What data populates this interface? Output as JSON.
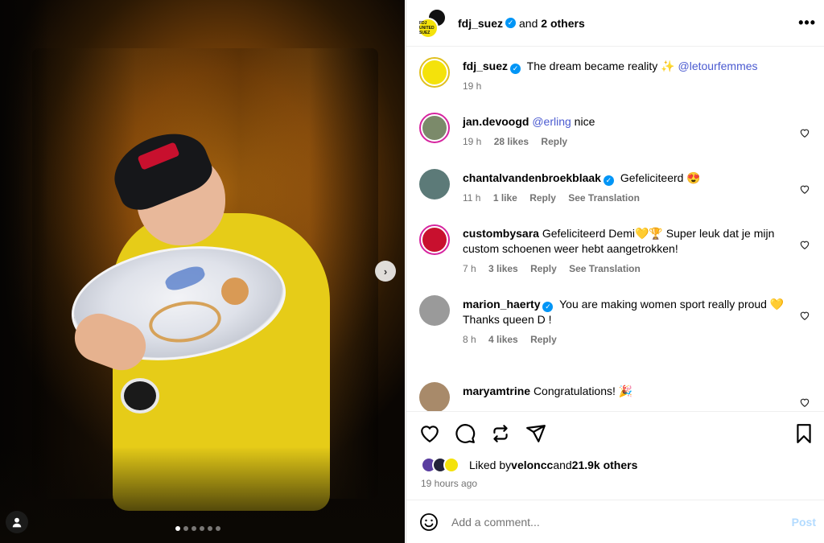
{
  "post": {
    "header": {
      "username": "fdj_suez",
      "and": "and",
      "others": "2 others",
      "more": "•••",
      "avatar_text": "FDJ UNITED SUEZ"
    },
    "next_arrow": "›",
    "carousel_dots": 6,
    "caption": {
      "username": "fdj_suez",
      "text": "The dream became reality ✨",
      "mention": "@letourfemmes",
      "time": "19 h"
    },
    "comments": [
      {
        "username": "jan.devoogd",
        "mention": "@erling",
        "text": " nice",
        "time": "19 h",
        "likes": "28 likes",
        "reply": "Reply",
        "avatar_color": "#7b8a6a"
      },
      {
        "username": "chantalvandenbroekblaak",
        "verified": true,
        "text": "Gefeliciteerd 😍",
        "time": "11 h",
        "likes": "1 like",
        "reply": "Reply",
        "translation": "See Translation",
        "avatar_color": "#5c7a78"
      },
      {
        "username": "custombysara",
        "text": "Gefeliciteerd Demi💛🏆 Super leuk dat je mijn custom schoenen weer hebt aangetrokken!",
        "time": "7 h",
        "likes": "3 likes",
        "reply": "Reply",
        "translation": "See Translation",
        "avatar_color": "#c8102e"
      },
      {
        "username": "marion_haerty",
        "verified": true,
        "text": "You are making women sport really proud 💛",
        "text2": "Thanks queen D !",
        "time": "8 h",
        "likes": "4 likes",
        "reply": "Reply",
        "avatar_color": "#9a9a9a"
      },
      {
        "username": "maryamtrine",
        "text": "Congratulations! 🎉",
        "avatar_color": "#a88a6a"
      }
    ],
    "likes": {
      "prefix": "Liked by ",
      "user": "velon­cc",
      "middle": " and ",
      "count": "21.9k others"
    },
    "time_ago": "19 hours ago",
    "add_comment": {
      "placeholder": "Add a comment...",
      "post": "Post"
    }
  }
}
